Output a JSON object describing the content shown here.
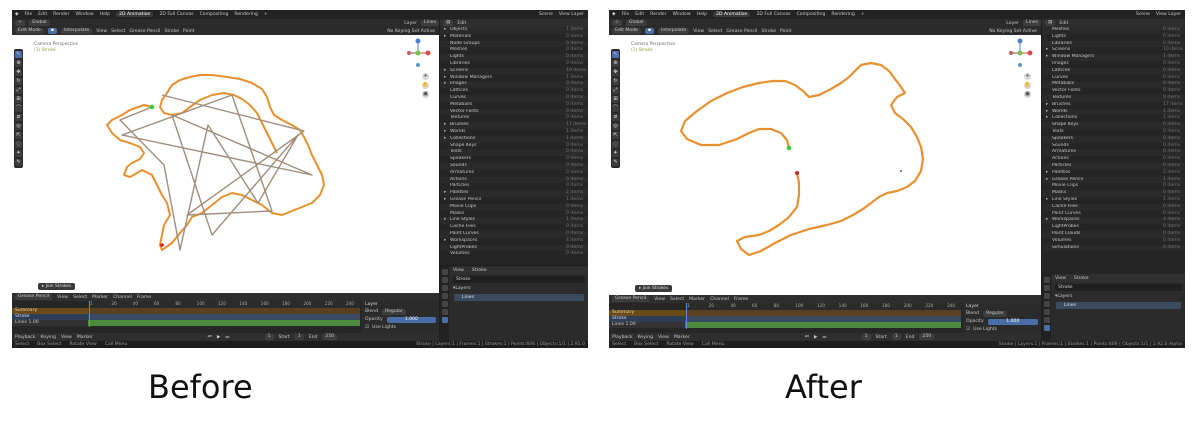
{
  "captions": {
    "before": "Before",
    "after": "After"
  },
  "menu": {
    "items": [
      "File",
      "Edit",
      "Render",
      "Window",
      "Help"
    ]
  },
  "workspaces": {
    "active": "2D Animation",
    "others": [
      "2D Full Canvas",
      "Compositing",
      "Rendering",
      "+"
    ]
  },
  "scene": {
    "scene_label": "Scene",
    "view_layer_label": "View Layer"
  },
  "viewport": {
    "mode": "Edit Mode",
    "orientation": "Global",
    "interpolate": "Interpolate",
    "menus": [
      "View",
      "Select",
      "Grease Pencil",
      "Stroke",
      "Point"
    ],
    "layer_label": "Layer",
    "layer_value": "Lines",
    "keying": "No Keying Set Active",
    "camera": "Camera Perspective",
    "object": "(1) Stroke",
    "operator": "Join Strokes"
  },
  "outliner": {
    "filter": "Edit",
    "before": [
      {
        "name": "Objects",
        "count": "1 items",
        "arrow": "▸"
      },
      {
        "name": "Materials",
        "count": "0 items",
        "arrow": "▸"
      },
      {
        "name": "Node Groups",
        "count": "0 items",
        "arrow": ""
      },
      {
        "name": "Meshes",
        "count": "0 items",
        "arrow": ""
      },
      {
        "name": "Lights",
        "count": "0 items",
        "arrow": ""
      },
      {
        "name": "Libraries",
        "count": "0 items",
        "arrow": ""
      },
      {
        "name": "Screens",
        "count": "10 items",
        "arrow": "▸"
      },
      {
        "name": "Window Managers",
        "count": "1 items",
        "arrow": "▸"
      },
      {
        "name": "Images",
        "count": "0 items",
        "arrow": "▸"
      },
      {
        "name": "Lattices",
        "count": "0 items",
        "arrow": ""
      },
      {
        "name": "Curves",
        "count": "0 items",
        "arrow": ""
      },
      {
        "name": "Metaballs",
        "count": "0 items",
        "arrow": ""
      },
      {
        "name": "Vector Fonts",
        "count": "0 items",
        "arrow": ""
      },
      {
        "name": "Textures",
        "count": "0 items",
        "arrow": ""
      },
      {
        "name": "Brushes",
        "count": "17 items",
        "arrow": "▸"
      },
      {
        "name": "Worlds",
        "count": "1 items",
        "arrow": "▸"
      },
      {
        "name": "Collections",
        "count": "1 items",
        "arrow": "▸"
      },
      {
        "name": "Shape Keys",
        "count": "0 items",
        "arrow": ""
      },
      {
        "name": "Texts",
        "count": "0 items",
        "arrow": ""
      },
      {
        "name": "Speakers",
        "count": "0 items",
        "arrow": ""
      },
      {
        "name": "Sounds",
        "count": "0 items",
        "arrow": ""
      },
      {
        "name": "Armatures",
        "count": "0 items",
        "arrow": ""
      },
      {
        "name": "Actions",
        "count": "0 items",
        "arrow": ""
      },
      {
        "name": "Particles",
        "count": "0 items",
        "arrow": ""
      },
      {
        "name": "Palettes",
        "count": "2 items",
        "arrow": "▸"
      },
      {
        "name": "Grease Pencil",
        "count": "1 items",
        "arrow": "▸"
      },
      {
        "name": "Movie Clips",
        "count": "0 items",
        "arrow": ""
      },
      {
        "name": "Masks",
        "count": "0 items",
        "arrow": ""
      },
      {
        "name": "Line Styles",
        "count": "1 items",
        "arrow": "▸"
      },
      {
        "name": "Cache Files",
        "count": "0 items",
        "arrow": ""
      },
      {
        "name": "Paint Curves",
        "count": "0 items",
        "arrow": ""
      },
      {
        "name": "Workspaces",
        "count": "4 items",
        "arrow": "▸"
      },
      {
        "name": "LightProbes",
        "count": "0 items",
        "arrow": ""
      },
      {
        "name": "Volumes",
        "count": "0 items",
        "arrow": ""
      }
    ],
    "after": [
      {
        "name": "Meshes",
        "count": "0 items",
        "arrow": ""
      },
      {
        "name": "Lights",
        "count": "0 items",
        "arrow": ""
      },
      {
        "name": "Libraries",
        "count": "0 items",
        "arrow": ""
      },
      {
        "name": "Screens",
        "count": "10 items",
        "arrow": "▸"
      },
      {
        "name": "Window Managers",
        "count": "1 items",
        "arrow": "▸"
      },
      {
        "name": "Images",
        "count": "0 items",
        "arrow": ""
      },
      {
        "name": "Lattices",
        "count": "0 items",
        "arrow": ""
      },
      {
        "name": "Curves",
        "count": "0 items",
        "arrow": ""
      },
      {
        "name": "Metaballs",
        "count": "0 items",
        "arrow": ""
      },
      {
        "name": "Vector Fonts",
        "count": "0 items",
        "arrow": ""
      },
      {
        "name": "Textures",
        "count": "0 items",
        "arrow": ""
      },
      {
        "name": "Brushes",
        "count": "17 items",
        "arrow": "▸"
      },
      {
        "name": "Worlds",
        "count": "1 items",
        "arrow": "▸"
      },
      {
        "name": "Collections",
        "count": "1 items",
        "arrow": "▸"
      },
      {
        "name": "Shape Keys",
        "count": "0 items",
        "arrow": ""
      },
      {
        "name": "Texts",
        "count": "0 items",
        "arrow": ""
      },
      {
        "name": "Speakers",
        "count": "0 items",
        "arrow": ""
      },
      {
        "name": "Sounds",
        "count": "0 items",
        "arrow": ""
      },
      {
        "name": "Armatures",
        "count": "0 items",
        "arrow": ""
      },
      {
        "name": "Actions",
        "count": "0 items",
        "arrow": ""
      },
      {
        "name": "Particles",
        "count": "0 items",
        "arrow": ""
      },
      {
        "name": "Palettes",
        "count": "2 items",
        "arrow": "▸"
      },
      {
        "name": "Grease Pencil",
        "count": "1 items",
        "arrow": "▸"
      },
      {
        "name": "Movie Clips",
        "count": "0 items",
        "arrow": ""
      },
      {
        "name": "Masks",
        "count": "0 items",
        "arrow": ""
      },
      {
        "name": "Line Styles",
        "count": "1 items",
        "arrow": "▸"
      },
      {
        "name": "Cache Files",
        "count": "0 items",
        "arrow": ""
      },
      {
        "name": "Paint Curves",
        "count": "0 items",
        "arrow": ""
      },
      {
        "name": "Workspaces",
        "count": "4 items",
        "arrow": "▸"
      },
      {
        "name": "LightProbes",
        "count": "0 items",
        "arrow": ""
      },
      {
        "name": "Point Clouds",
        "count": "0 items",
        "arrow": ""
      },
      {
        "name": "Volumes",
        "count": "0 items",
        "arrow": ""
      },
      {
        "name": "Simulations",
        "count": "0 items",
        "arrow": ""
      }
    ]
  },
  "properties": {
    "tab_view": "View",
    "tab_stroke": "Stroke",
    "object_name": "Stroke",
    "layers_section": "Layers",
    "layer_name": "Lines"
  },
  "timeline": {
    "mode": "Grease Pencil",
    "menus": [
      "View",
      "Select",
      "Marker",
      "Channel",
      "Frame"
    ],
    "ticks": [
      "1",
      "20",
      "40",
      "60",
      "80",
      "100",
      "120",
      "140",
      "160",
      "180",
      "200",
      "220",
      "240"
    ],
    "summary": "Summary",
    "stroke": "Stroke",
    "lines": "Lines",
    "lines_value": "1.00",
    "layer_panel_title": "Layer",
    "blend_label": "Blend",
    "blend_value": "Regular",
    "opacity_label": "Opacity",
    "opacity_value": "1.000",
    "use_lights": "Use Lights",
    "playback": [
      "Playback",
      "Keying",
      "View",
      "Marker"
    ],
    "current_frame": "1",
    "start_label": "Start",
    "start_value": "1",
    "end_label": "End",
    "end_value": "250"
  },
  "status": {
    "hints": [
      "Select",
      "Box Select",
      "Rotate View",
      "Call Menu"
    ],
    "stats_before": "Stroke | Layers:1 | Frames:1 | Strokes:1 | Points:606 | Objects:1/1 | 2.91.0",
    "stats_after": "Stroke | Layers:1 | Frames:1 | Strokes:1 | Points:606 | Objects:1/1 | 2.92.0 Alpha"
  },
  "colors": {
    "stroke_orange": "#e8902f",
    "stroke_gray": "#a08e7c",
    "point_green": "#2ecc2e",
    "point_red": "#cc2222",
    "track_green": "#4e8a3e",
    "accent_blue": "#4a6ea8"
  }
}
